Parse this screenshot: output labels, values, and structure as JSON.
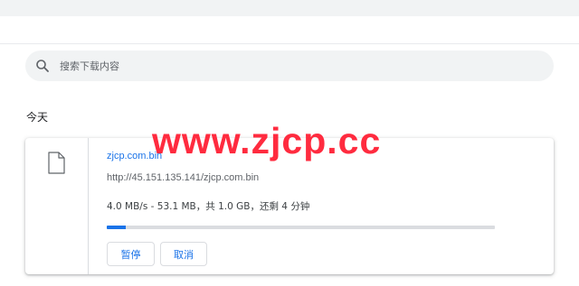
{
  "search": {
    "placeholder": "搜索下载内容"
  },
  "section": {
    "label": "今天"
  },
  "download": {
    "file_name": "zjcp.com.bin",
    "url": "http://45.151.135.141/zjcp.com.bin",
    "progress_text": "4.0 MB/s - 53.1 MB，共 1.0 GB，还剩 4 分钟",
    "progress_fraction": 0.05,
    "pause_label": "暂停",
    "cancel_label": "取消"
  },
  "watermark": {
    "text": "www.zjcp.cc"
  },
  "colors": {
    "accent": "#1a73e8",
    "watermark": "#ff2b3f",
    "search_bg": "#f1f3f4"
  },
  "icons": {
    "search": "search-icon",
    "file": "file-icon"
  }
}
